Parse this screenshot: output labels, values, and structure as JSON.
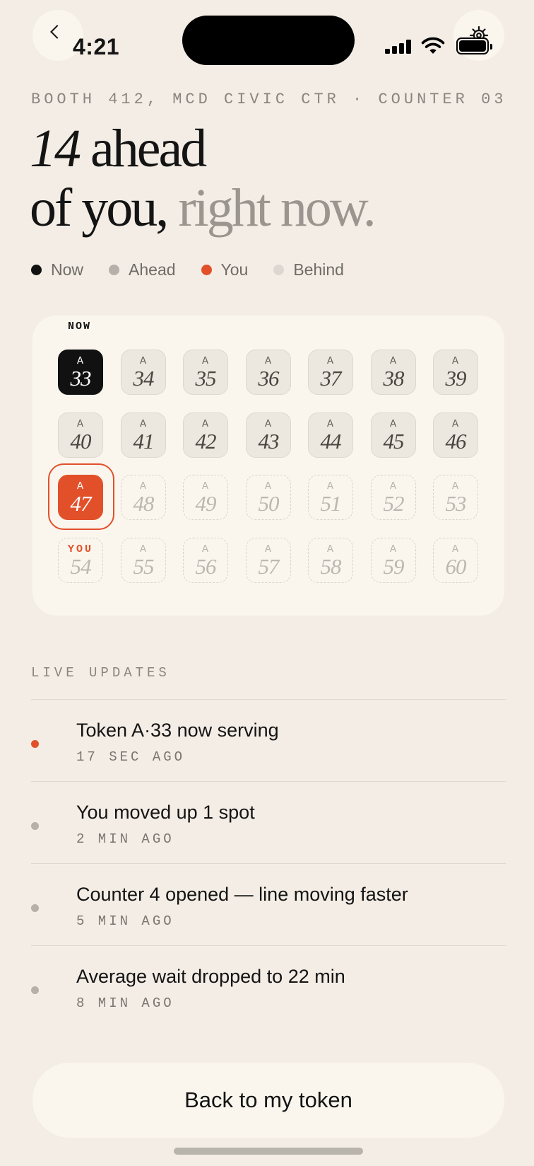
{
  "status_bar": {
    "time": "4:21"
  },
  "header": {
    "location": "BOOTH 412, MCD CIVIC CTR · COUNTER 03",
    "ahead_count": "14",
    "headline_rest": " ahead",
    "line2_dark": "of you,",
    "line2_muted": " right now."
  },
  "legend": [
    {
      "label": "Now",
      "color": "#111111"
    },
    {
      "label": "Ahead",
      "color": "#b5b0a9"
    },
    {
      "label": "You",
      "color": "#e2502a"
    },
    {
      "label": "Behind",
      "color": "#dcd7d0"
    }
  ],
  "queue": {
    "now_label": "NOW",
    "you_tag": "YOU",
    "series_letter": "A",
    "tokens": [
      {
        "n": "33",
        "state": "now"
      },
      {
        "n": "34",
        "state": "ahead"
      },
      {
        "n": "35",
        "state": "ahead"
      },
      {
        "n": "36",
        "state": "ahead"
      },
      {
        "n": "37",
        "state": "ahead"
      },
      {
        "n": "38",
        "state": "ahead"
      },
      {
        "n": "39",
        "state": "ahead"
      },
      {
        "n": "40",
        "state": "ahead"
      },
      {
        "n": "41",
        "state": "ahead"
      },
      {
        "n": "42",
        "state": "ahead"
      },
      {
        "n": "43",
        "state": "ahead"
      },
      {
        "n": "44",
        "state": "ahead"
      },
      {
        "n": "45",
        "state": "ahead"
      },
      {
        "n": "46",
        "state": "ahead"
      },
      {
        "n": "47",
        "state": "you"
      },
      {
        "n": "48",
        "state": "behind"
      },
      {
        "n": "49",
        "state": "behind"
      },
      {
        "n": "50",
        "state": "behind"
      },
      {
        "n": "51",
        "state": "behind"
      },
      {
        "n": "52",
        "state": "behind"
      },
      {
        "n": "53",
        "state": "behind"
      },
      {
        "n": "54",
        "state": "behind",
        "tag": "YOU"
      },
      {
        "n": "55",
        "state": "behind"
      },
      {
        "n": "56",
        "state": "behind"
      },
      {
        "n": "57",
        "state": "behind"
      },
      {
        "n": "58",
        "state": "behind"
      },
      {
        "n": "59",
        "state": "behind"
      },
      {
        "n": "60",
        "state": "behind"
      }
    ]
  },
  "updates": {
    "title": "LIVE UPDATES",
    "items": [
      {
        "text": "Token A·33 now serving",
        "time": "17 SEC AGO",
        "color": "#e2502a"
      },
      {
        "text": "You moved up 1 spot",
        "time": "2 MIN AGO",
        "color": "#b5b0a9"
      },
      {
        "text": "Counter 4 opened — line moving faster",
        "time": "5 MIN AGO",
        "color": "#b5b0a9"
      },
      {
        "text": "Average wait dropped to 22 min",
        "time": "8 MIN AGO",
        "color": "#b5b0a9"
      }
    ]
  },
  "actions": {
    "back_to_token": "Back to my token"
  },
  "icons": {
    "back": "chevron-left-icon",
    "settings": "gear-icon"
  }
}
